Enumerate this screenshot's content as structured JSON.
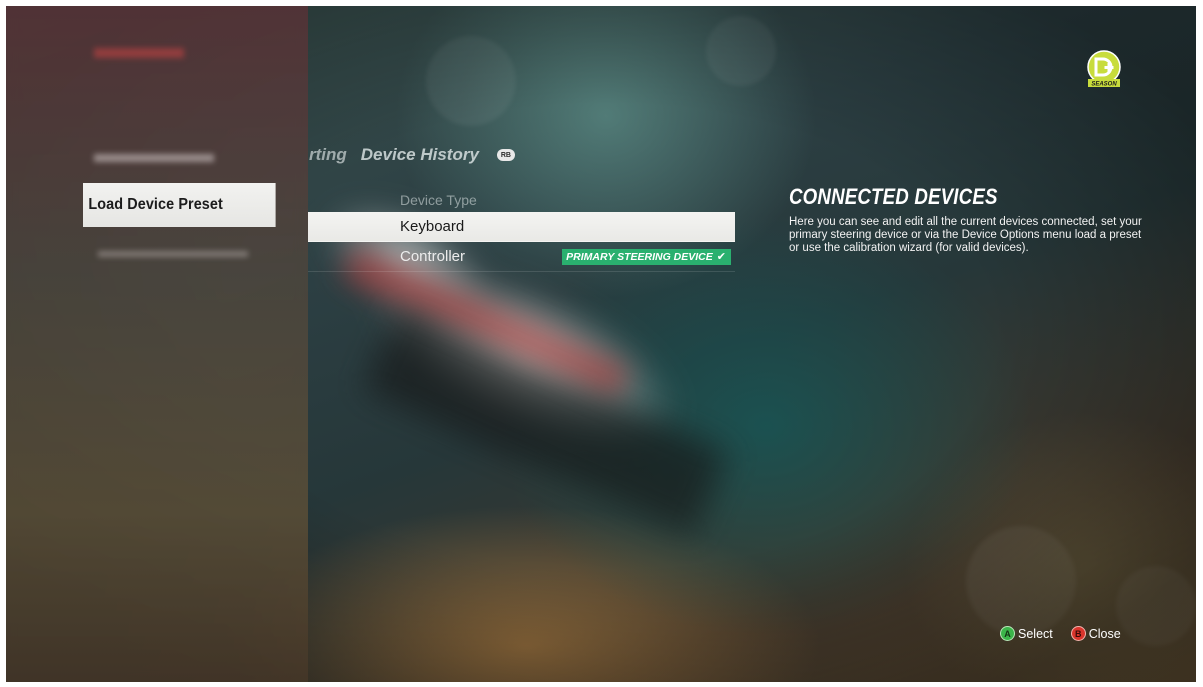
{
  "tabs": {
    "previous_partial": "rting",
    "current": "Device History",
    "bumper_button": "RB"
  },
  "left_menu": {
    "selected_item": "Load Device Preset"
  },
  "device_list": {
    "column_header": "Device Type",
    "rows": [
      {
        "label": "Keyboard",
        "selected": true
      },
      {
        "label": "Controller",
        "selected": false,
        "badge": "PRIMARY STEERING DEVICE",
        "badge_icon": "check-icon"
      }
    ]
  },
  "info": {
    "title": "CONNECTED DEVICES",
    "body": "Here you can see and edit all the current devices connected, set your primary steering device or via the Device Options menu load a preset or use the calibration wizard (for valid devices)."
  },
  "season_logo": {
    "text": "SEASON",
    "icon": "season-logo-icon"
  },
  "footer": {
    "select_button": "A",
    "select_label": "Select",
    "close_button": "B",
    "close_label": "Close"
  },
  "colors": {
    "badge_green": "#2ab06f",
    "button_a": "#3cb44a",
    "button_b": "#d9342b",
    "logo_yellow": "#c8dc3c"
  }
}
